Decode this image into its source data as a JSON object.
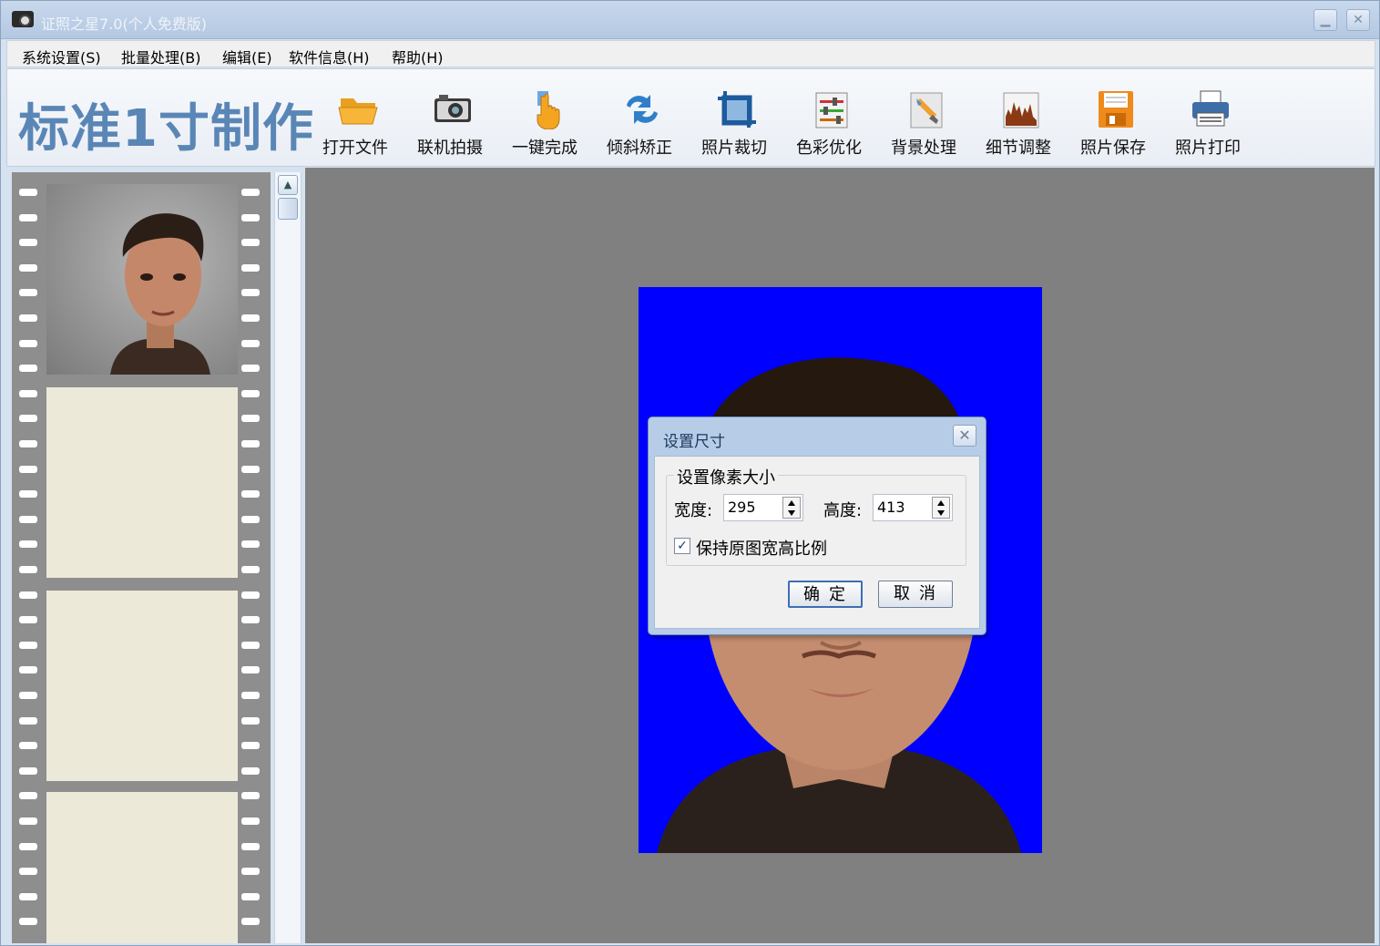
{
  "window": {
    "title": "证照之星7.0(个人免费版)",
    "min_glyph": "▁",
    "max_glyph": "✕"
  },
  "menu": [
    {
      "label": "系统设置(S)"
    },
    {
      "label": "批量处理(B)"
    },
    {
      "label": "编辑(E)"
    },
    {
      "label": "软件信息(H)"
    },
    {
      "label": "帮助(H)"
    }
  ],
  "toolbar": {
    "brand": "标准1寸制作",
    "tools": [
      {
        "label": "打开文件",
        "icon": "folder-icon"
      },
      {
        "label": "联机拍摄",
        "icon": "camera-icon"
      },
      {
        "label": "一键完成",
        "icon": "hand-pointer-icon"
      },
      {
        "label": "倾斜矫正",
        "icon": "rotate-arrows-icon"
      },
      {
        "label": "照片裁切",
        "icon": "crop-icon"
      },
      {
        "label": "色彩优化",
        "icon": "color-sliders-icon"
      },
      {
        "label": "背景处理",
        "icon": "paint-brush-icon"
      },
      {
        "label": "细节调整",
        "icon": "histogram-icon"
      },
      {
        "label": "照片保存",
        "icon": "floppy-save-icon"
      },
      {
        "label": "照片打印",
        "icon": "printer-icon"
      }
    ]
  },
  "scrollbar": {
    "up_glyph": "▲"
  },
  "photo": {
    "background": "#0000ff"
  },
  "dialog": {
    "title": "设置尺寸",
    "close_glyph": "✕",
    "group_label": "设置像素大小",
    "width_label": "宽度:",
    "width_value": "295",
    "height_label": "高度:",
    "height_value": "413",
    "keep_ratio_label": "保持原图宽高比例",
    "keep_ratio_checked": true,
    "check_glyph": "✓",
    "ok_label": "确定",
    "cancel_label": "取消"
  }
}
